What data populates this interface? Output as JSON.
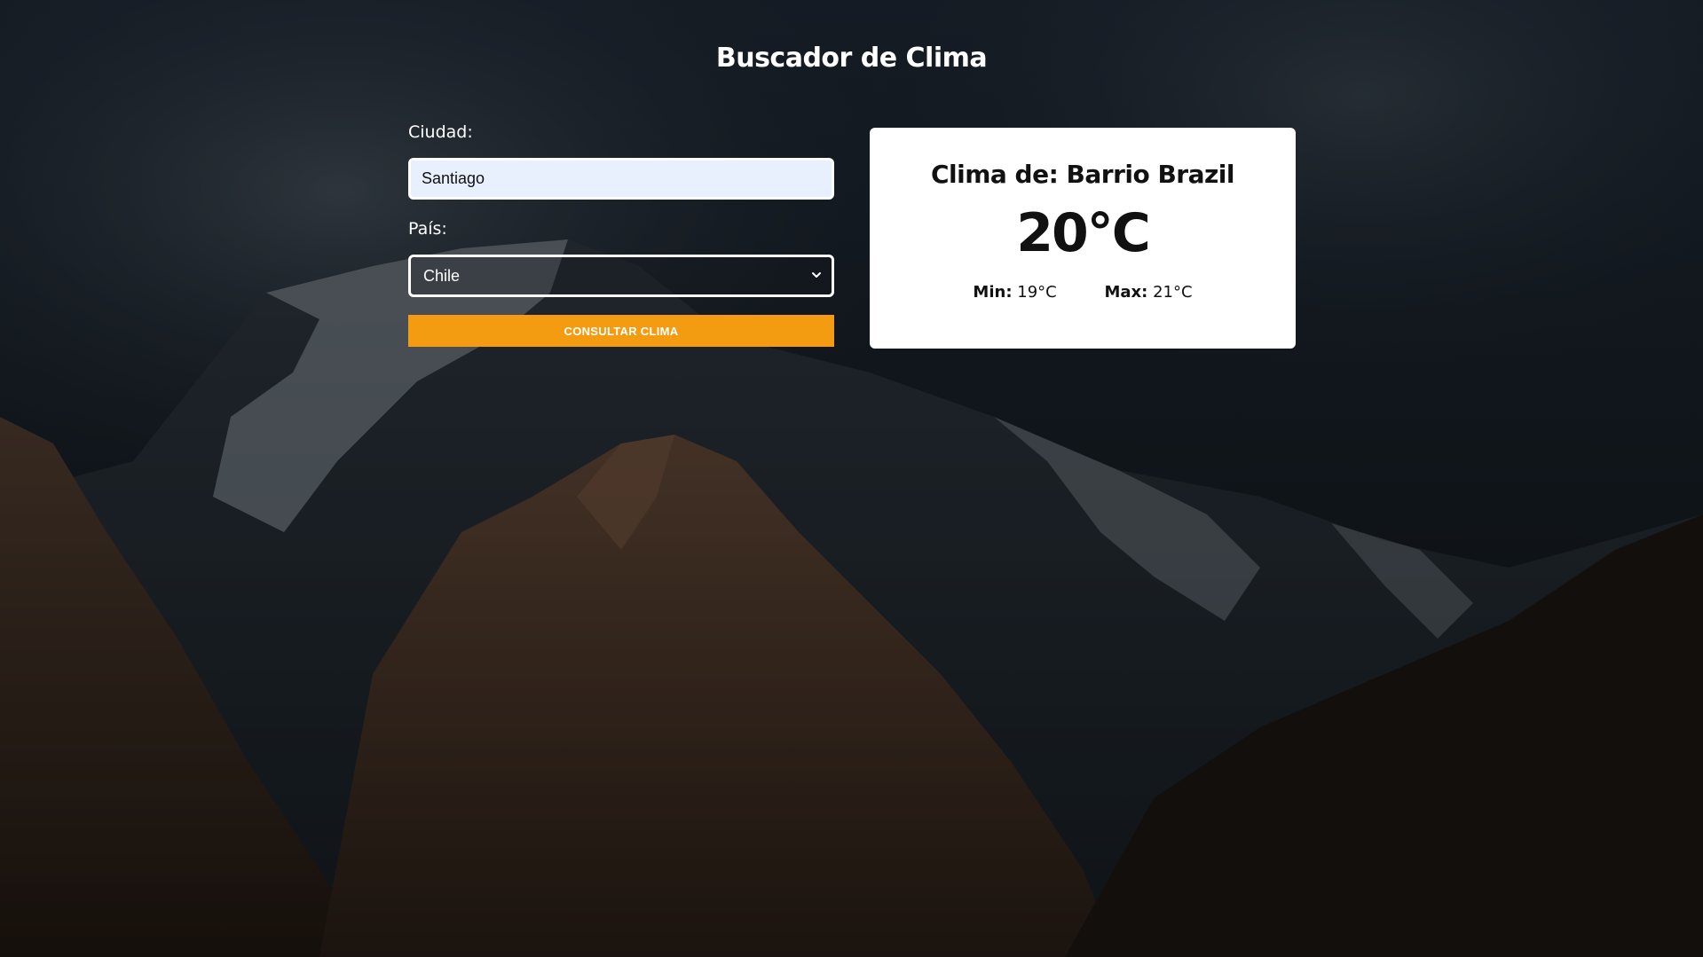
{
  "app": {
    "title": "Buscador de Clima"
  },
  "form": {
    "city_label": "Ciudad:",
    "city_value": "Santiago",
    "country_label": "País:",
    "country_selected": "Chile",
    "submit_label": "CONSULTAR CLIMA"
  },
  "result": {
    "heading": "Clima de: Barrio Brazil",
    "temperature": "20°C",
    "min_label": "Min:",
    "min_value": "19°C",
    "max_label": "Max:",
    "max_value": "21°C"
  },
  "colors": {
    "accent": "#f39c12",
    "card_bg": "#ffffff",
    "input_bg": "#e8f0fe"
  },
  "icons": {
    "select_arrow": "chevron-down-icon"
  }
}
